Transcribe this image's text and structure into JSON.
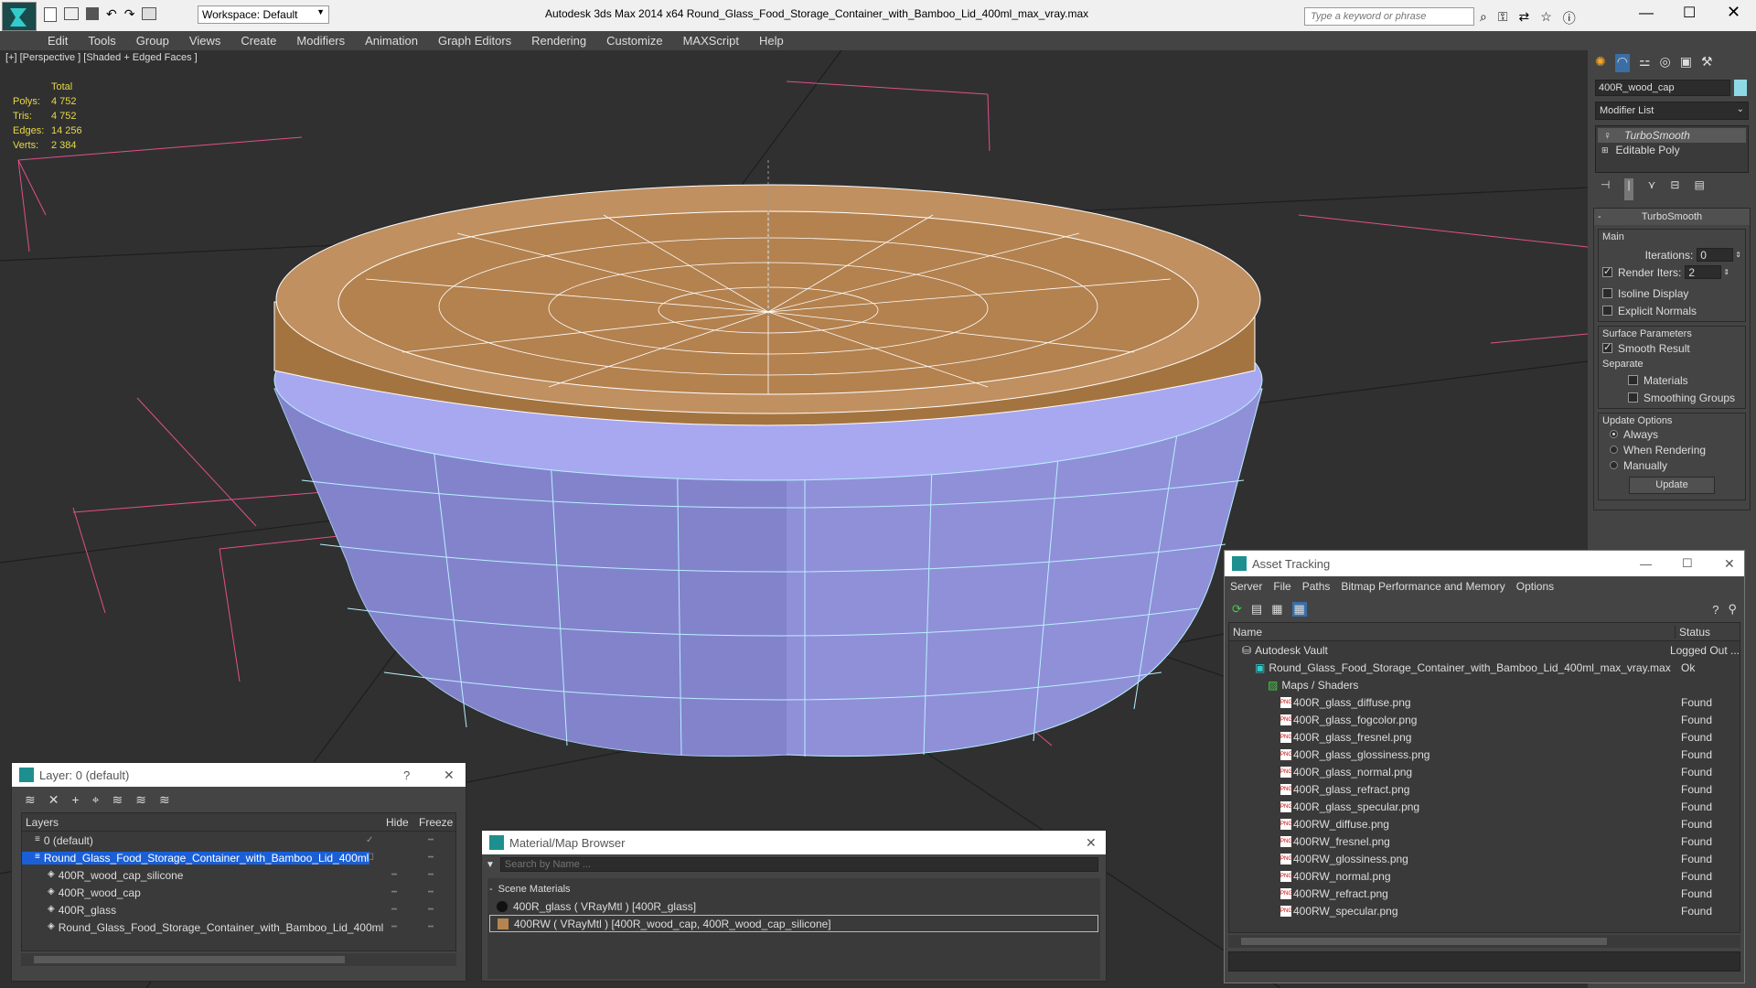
{
  "titlebar": {
    "workspace_label": "Workspace: Default",
    "title": "Autodesk 3ds Max  2014 x64      Round_Glass_Food_Storage_Container_with_Bamboo_Lid_400ml_max_vray.max",
    "search_placeholder": "Type a keyword or phrase"
  },
  "menu": [
    "Edit",
    "Tools",
    "Group",
    "Views",
    "Create",
    "Modifiers",
    "Animation",
    "Graph Editors",
    "Rendering",
    "Customize",
    "MAXScript",
    "Help"
  ],
  "viewport": {
    "label": "[+] [Perspective ] [Shaded + Edged Faces ]",
    "stats_header": "Total",
    "stats": [
      {
        "label": "Polys:",
        "value": "4 752"
      },
      {
        "label": "Tris:",
        "value": "4 752"
      },
      {
        "label": "Edges:",
        "value": "14 256"
      },
      {
        "label": "Verts:",
        "value": "2 384"
      }
    ]
  },
  "command_panel": {
    "object_name": "400R_wood_cap",
    "modifier_list": "Modifier List",
    "stack": [
      "TurboSmooth",
      "Editable Poly"
    ],
    "rollout_title": "TurboSmooth",
    "main_label": "Main",
    "iterations_label": "Iterations:",
    "iterations_value": "0",
    "render_iters_label": "Render Iters:",
    "render_iters_value": "2",
    "isoline": "Isoline Display",
    "explicit": "Explicit Normals",
    "surface_params": "Surface Parameters",
    "smooth_result": "Smooth Result",
    "separate": "Separate",
    "materials": "Materials",
    "smoothing_groups": "Smoothing Groups",
    "update_options": "Update Options",
    "always": "Always",
    "when_rendering": "When Rendering",
    "manually": "Manually",
    "update_btn": "Update"
  },
  "layer_window": {
    "title": "Layer: 0 (default)",
    "help": "?",
    "col_layers": "Layers",
    "col_hide": "Hide",
    "col_freeze": "Freeze",
    "rows": [
      {
        "name": "0 (default)",
        "indent": 1
      },
      {
        "name": "Round_Glass_Food_Storage_Container_with_Bamboo_Lid_400ml",
        "indent": 1,
        "selected": true
      },
      {
        "name": "400R_wood_cap_silicone",
        "indent": 2
      },
      {
        "name": "400R_wood_cap",
        "indent": 2
      },
      {
        "name": "400R_glass",
        "indent": 2
      },
      {
        "name": "Round_Glass_Food_Storage_Container_with_Bamboo_Lid_400ml",
        "indent": 2
      }
    ]
  },
  "material_browser": {
    "title": "Material/Map Browser",
    "search_placeholder": "Search by Name ...",
    "section": "Scene Materials",
    "items": [
      "400R_glass  ( VRayMtl ) [400R_glass]",
      "400RW  ( VRayMtl ) [400R_wood_cap, 400R_wood_cap_silicone]"
    ]
  },
  "asset_tracking": {
    "title": "Asset Tracking",
    "menu": [
      "Server",
      "File",
      "Paths",
      "Bitmap Performance and Memory",
      "Options"
    ],
    "col_name": "Name",
    "col_status": "Status",
    "rows": [
      {
        "name": "Autodesk Vault",
        "status": "Logged Out ...",
        "level": 1,
        "kind": "vault"
      },
      {
        "name": "Round_Glass_Food_Storage_Container_with_Bamboo_Lid_400ml_max_vray.max",
        "status": "Ok",
        "level": 2,
        "kind": "max"
      },
      {
        "name": "Maps / Shaders",
        "status": "",
        "level": 3,
        "kind": "folder"
      },
      {
        "name": "400R_glass_diffuse.png",
        "status": "Found",
        "level": 4,
        "kind": "png"
      },
      {
        "name": "400R_glass_fogcolor.png",
        "status": "Found",
        "level": 4,
        "kind": "png"
      },
      {
        "name": "400R_glass_fresnel.png",
        "status": "Found",
        "level": 4,
        "kind": "png"
      },
      {
        "name": "400R_glass_glossiness.png",
        "status": "Found",
        "level": 4,
        "kind": "png"
      },
      {
        "name": "400R_glass_normal.png",
        "status": "Found",
        "level": 4,
        "kind": "png"
      },
      {
        "name": "400R_glass_refract.png",
        "status": "Found",
        "level": 4,
        "kind": "png"
      },
      {
        "name": "400R_glass_specular.png",
        "status": "Found",
        "level": 4,
        "kind": "png"
      },
      {
        "name": "400RW_diffuse.png",
        "status": "Found",
        "level": 4,
        "kind": "png"
      },
      {
        "name": "400RW_fresnel.png",
        "status": "Found",
        "level": 4,
        "kind": "png"
      },
      {
        "name": "400RW_glossiness.png",
        "status": "Found",
        "level": 4,
        "kind": "png"
      },
      {
        "name": "400RW_normal.png",
        "status": "Found",
        "level": 4,
        "kind": "png"
      },
      {
        "name": "400RW_refract.png",
        "status": "Found",
        "level": 4,
        "kind": "png"
      },
      {
        "name": "400RW_specular.png",
        "status": "Found",
        "level": 4,
        "kind": "png"
      }
    ]
  },
  "colors": {
    "stats_yellow": "#e6d84a",
    "glass_blue": "#9a9ae0",
    "wood": "#b58550",
    "selection": "#1a5fd6"
  }
}
